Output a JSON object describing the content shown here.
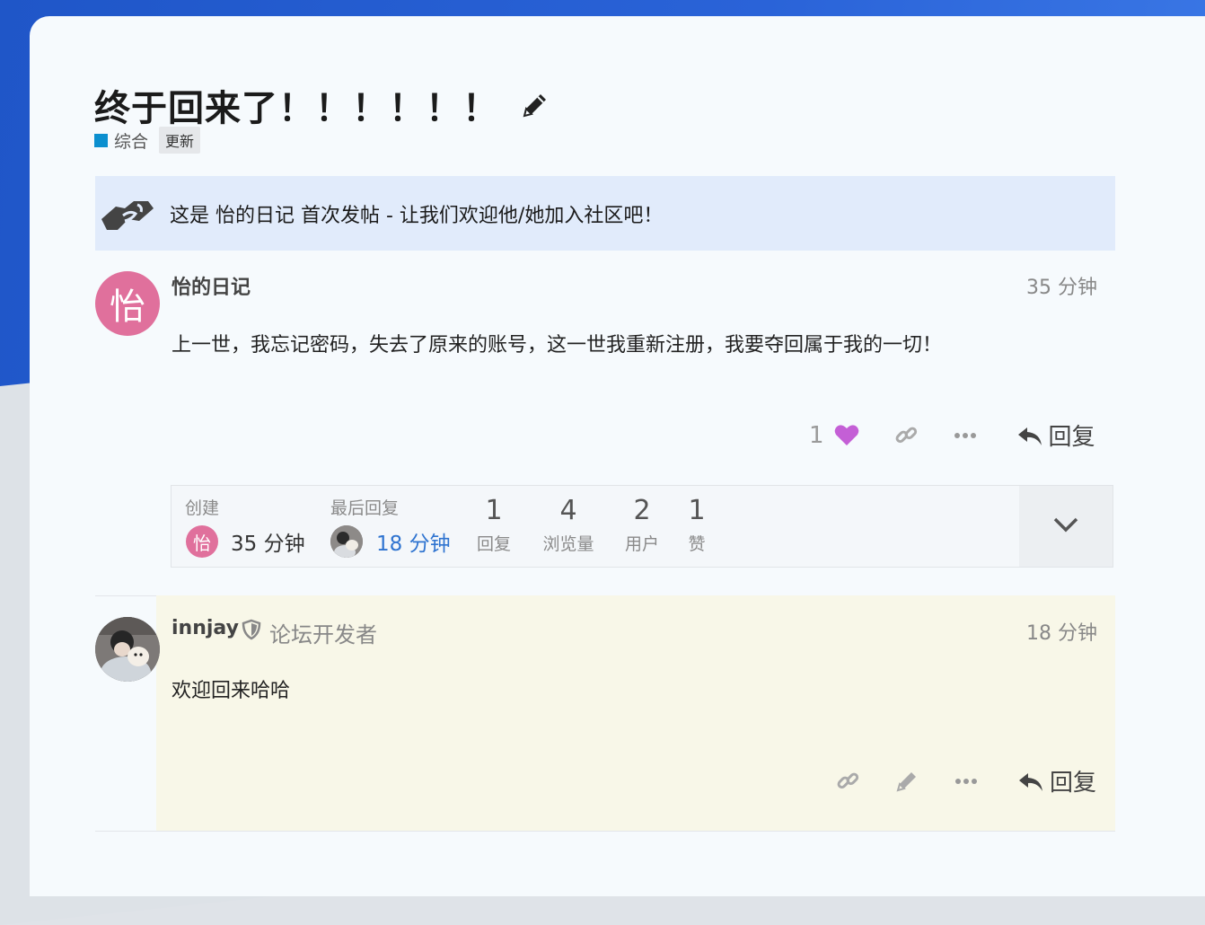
{
  "topic": {
    "title": "终于回来了！！！！！！",
    "category": "综合",
    "category_color": "#0b8fcf",
    "tag": "更新"
  },
  "notice": {
    "text": "这是 怡的日记 首次发帖 - 让我们欢迎他/她加入社区吧！"
  },
  "post1": {
    "avatar_letter": "怡",
    "username": "怡的日记",
    "time": "35 分钟",
    "body": "上一世，我忘记密码，失去了原来的账号，这一世我重新注册，我要夺回属于我的一切！",
    "like_count": "1",
    "reply_label": "回复"
  },
  "summary": {
    "created_label": "创建",
    "created_avatar": "怡",
    "created_time": "35 分钟",
    "last_reply_label": "最后回复",
    "last_reply_time": "18 分钟",
    "replies_num": "1",
    "replies_label": "回复",
    "views_num": "4",
    "views_label": "浏览量",
    "users_num": "2",
    "users_label": "用户",
    "likes_num": "1",
    "likes_label": "赞"
  },
  "post2": {
    "username": "innjay",
    "flair": "论坛开发者",
    "time": "18 分钟",
    "body": "欢迎回来哈哈",
    "reply_label": "回复"
  }
}
